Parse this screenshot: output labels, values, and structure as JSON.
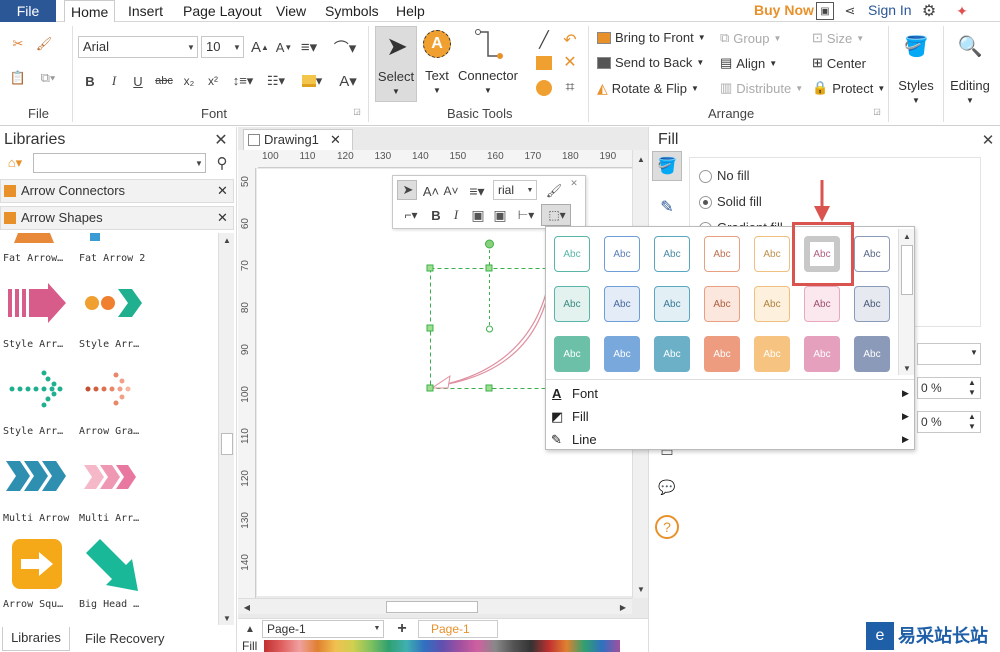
{
  "menubar": {
    "file": "File",
    "items": [
      "Home",
      "Insert",
      "Page Layout",
      "View",
      "Symbols",
      "Help"
    ],
    "buy_now": "Buy Now",
    "sign_in": "Sign In"
  },
  "ribbon": {
    "groups": [
      "File",
      "Font",
      "Basic Tools",
      "Arrange",
      "Styles",
      "Editing"
    ],
    "font_name": "Arial",
    "font_size": "10",
    "tools": [
      "Select",
      "Text",
      "Connector"
    ],
    "arrange": {
      "bring_front": "Bring to Front",
      "send_back": "Send to Back",
      "rotate_flip": "Rotate & Flip",
      "group": "Group",
      "align": "Align",
      "distribute": "Distribute",
      "size": "Size",
      "center": "Center",
      "protect": "Protect"
    },
    "styles": "Styles",
    "editing": "Editing"
  },
  "libraries": {
    "title": "Libraries",
    "search_placeholder": "",
    "sections": [
      "Arrow Connectors",
      "Arrow Shapes"
    ],
    "shapes": [
      {
        "label": "Fat Arrow…",
        "color": "#e8893a"
      },
      {
        "label": "Fat Arrow 2",
        "color": "#3a9bd5"
      },
      {
        "label": "Style Arr…",
        "color": "#d85c8a"
      },
      {
        "label": "Style Arr…",
        "color": "#f0a030"
      },
      {
        "label": "Style Arr…",
        "color": "#20b090"
      },
      {
        "label": "Arrow Gra…",
        "color": "#c05030"
      },
      {
        "label": "Multi Arrow",
        "color": "#2f8fb0"
      },
      {
        "label": "Multi Arr…",
        "color": "#e878a0"
      },
      {
        "label": "Arrow Squ…",
        "color": "#f5a818"
      },
      {
        "label": "Big Head …",
        "color": "#18b898"
      }
    ]
  },
  "bottom_tabs": [
    "Libraries",
    "File Recovery"
  ],
  "document": {
    "tab": "Drawing1",
    "ruler_h": [
      "100",
      "110",
      "120",
      "130",
      "140",
      "150",
      "160",
      "170",
      "180",
      "190"
    ],
    "ruler_v": [
      "50",
      "60",
      "70",
      "80",
      "90",
      "100",
      "110",
      "120",
      "130",
      "140"
    ],
    "page_select": "Page-1",
    "page_tab": "Page-1",
    "fill_label": "Fill"
  },
  "minitoolbar": {
    "font": "rial"
  },
  "fill_panel": {
    "title": "Fill",
    "options": [
      "No fill",
      "Solid fill",
      "Gradient fill"
    ],
    "selected": "Solid fill",
    "percent1": "0 %",
    "percent2": "0 %"
  },
  "style_popup": {
    "swatch_text": "Abc",
    "rows": [
      [
        {
          "bg": "#ffffff",
          "border": "#5ab5a8",
          "text": "#5ab5a8"
        },
        {
          "bg": "#ffffff",
          "border": "#6d9ed8",
          "text": "#5b7fb8"
        },
        {
          "bg": "#ffffff",
          "border": "#5aa8c0",
          "text": "#4a8aa8"
        },
        {
          "bg": "#ffffff",
          "border": "#e8a080",
          "text": "#c07050"
        },
        {
          "bg": "#ffffff",
          "border": "#f0c080",
          "text": "#c09050"
        },
        {
          "bg": "#ffffff",
          "border": "#e8a8c0",
          "text": "#b06080"
        },
        {
          "bg": "#ffffff",
          "border": "#8a9ab8",
          "text": "#5a6a88"
        }
      ],
      [
        {
          "bg": "#e3f2ee",
          "border": "#5ab5a8",
          "text": "#3a8a80"
        },
        {
          "bg": "#e4ecf8",
          "border": "#6d9ed8",
          "text": "#4a6aa0"
        },
        {
          "bg": "#e2eff4",
          "border": "#5aa8c0",
          "text": "#3a7a98"
        },
        {
          "bg": "#fbe7de",
          "border": "#e8a080",
          "text": "#b06040"
        },
        {
          "bg": "#fdf1de",
          "border": "#f0c080",
          "text": "#b08040"
        },
        {
          "bg": "#fbe8ef",
          "border": "#e8a8c0",
          "text": "#a05070"
        },
        {
          "bg": "#e6e9f0",
          "border": "#8a9ab8",
          "text": "#4a5a78"
        }
      ],
      [
        {
          "bg": "#6cc0a8",
          "border": "#6cc0a8",
          "text": "#ffffff"
        },
        {
          "bg": "#78a8dc",
          "border": "#78a8dc",
          "text": "#ffffff"
        },
        {
          "bg": "#6cb0c8",
          "border": "#6cb0c8",
          "text": "#ffffff"
        },
        {
          "bg": "#ee9c80",
          "border": "#ee9c80",
          "text": "#ffffff"
        },
        {
          "bg": "#f6c480",
          "border": "#f6c480",
          "text": "#ffffff"
        },
        {
          "bg": "#e4a0bc",
          "border": "#e4a0bc",
          "text": "#ffffff"
        },
        {
          "bg": "#8a9ab8",
          "border": "#8a9ab8",
          "text": "#ffffff"
        }
      ]
    ],
    "menu": [
      "Font",
      "Fill",
      "Line"
    ],
    "highlight_color": "#d9534f"
  },
  "watermark": {
    "brand": "易采站长站"
  }
}
